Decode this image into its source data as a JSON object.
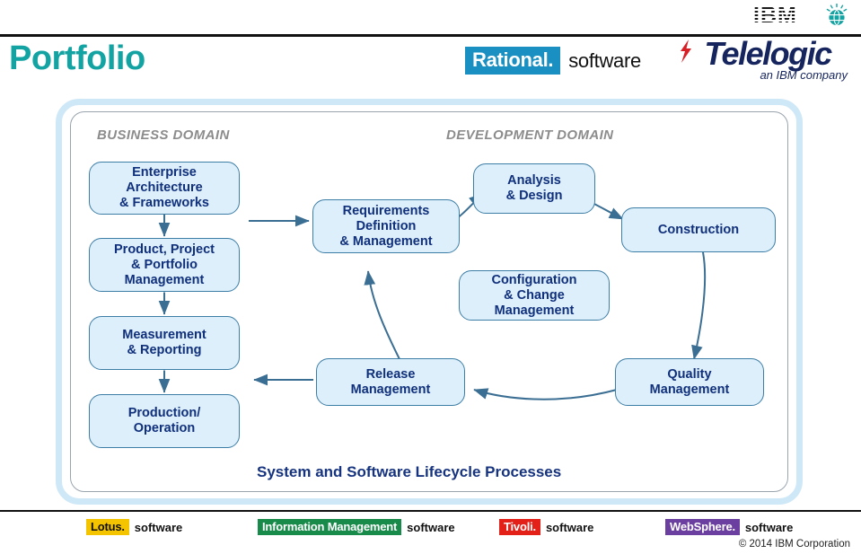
{
  "header": {
    "title": "Portfolio",
    "title_color": "#14a3a3",
    "ibm_logo_text": "IBM",
    "ibm_globe_icon": "globe-icon",
    "rational": {
      "mark": "Rational.",
      "word": "software",
      "mark_bg": "#1a8fc1"
    },
    "telelogic": {
      "mark": "Telelogic",
      "tagline": "an IBM company",
      "color": "#16255e",
      "flash_color": "#d81f26"
    }
  },
  "diagram": {
    "business_domain_label": "BUSINESS DOMAIN",
    "development_domain_label": "DEVELOPMENT DOMAIN",
    "caption": "System and Software Lifecycle Processes",
    "box_fill": "#ddeffb",
    "box_border": "#3d7ea6",
    "box_text_color": "#10307c",
    "business_boxes": [
      {
        "id": "enterprise-architecture",
        "label": "Enterprise\nArchitecture\n& Frameworks"
      },
      {
        "id": "product-project-portfolio",
        "label": "Product, Project\n& Portfolio\nManagement"
      },
      {
        "id": "measurement-reporting",
        "label": "Measurement\n& Reporting"
      },
      {
        "id": "production-operation",
        "label": "Production/\nOperation"
      }
    ],
    "development_boxes": [
      {
        "id": "requirements-definition",
        "label": "Requirements\nDefinition\n& Management"
      },
      {
        "id": "analysis-design",
        "label": "Analysis\n& Design"
      },
      {
        "id": "construction",
        "label": "Construction"
      },
      {
        "id": "configuration-change",
        "label": "Configuration\n& Change\nManagement"
      },
      {
        "id": "quality-management",
        "label": "Quality\nManagement"
      },
      {
        "id": "release-management",
        "label": "Release\nManagement"
      }
    ]
  },
  "footer": {
    "brands": [
      {
        "id": "lotus",
        "mark": "Lotus.",
        "word": "software",
        "bg": "#f5c400",
        "fg": "#111111"
      },
      {
        "id": "information-management",
        "mark": "Information Management",
        "word": "software",
        "bg": "#188a4a",
        "fg": "#ffffff"
      },
      {
        "id": "tivoli",
        "mark": "Tivoli.",
        "word": "software",
        "bg": "#e32119",
        "fg": "#ffffff"
      },
      {
        "id": "websphere",
        "mark": "WebSphere.",
        "word": "software",
        "bg": "#6b3fa0",
        "fg": "#ffffff"
      }
    ],
    "copyright": "© 2014 IBM Corporation"
  }
}
